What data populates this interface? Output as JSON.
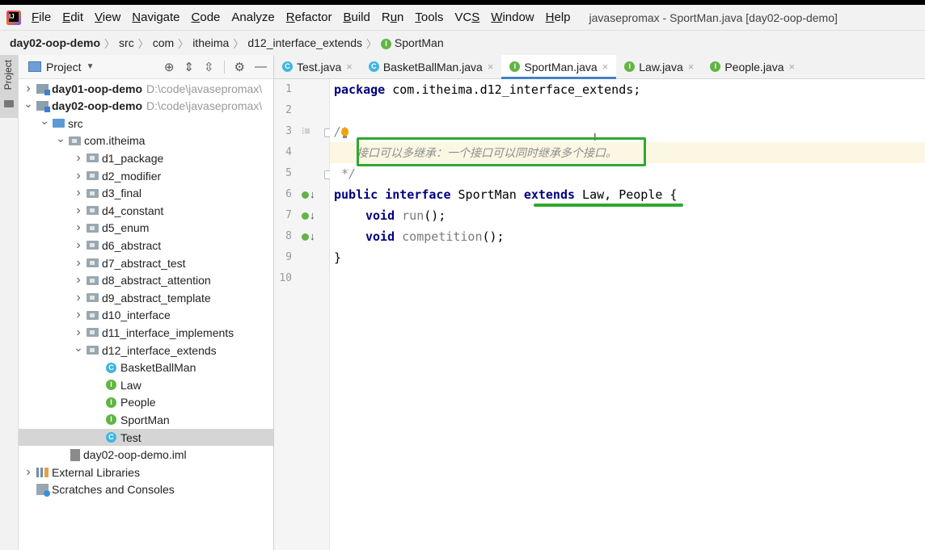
{
  "menubar": {
    "items": [
      {
        "label": "File",
        "u": "F",
        "rest": "ile"
      },
      {
        "label": "Edit",
        "u": "E",
        "rest": "dit"
      },
      {
        "label": "View",
        "u": "V",
        "rest": "iew"
      },
      {
        "label": "Navigate",
        "u": "N",
        "rest": "avigate"
      },
      {
        "label": "Code",
        "u": "C",
        "rest": "ode"
      },
      {
        "label": "Analyze",
        "u": "",
        "rest": "Analyze"
      },
      {
        "label": "Refactor",
        "u": "R",
        "rest": "efactor"
      },
      {
        "label": "Build",
        "u": "B",
        "rest": "uild"
      },
      {
        "label": "Run",
        "pre": "R",
        "u": "u",
        "rest": "n"
      },
      {
        "label": "Tools",
        "u": "T",
        "rest": "ools"
      },
      {
        "label": "VCS",
        "pre": "VC",
        "u": "S",
        "rest": ""
      },
      {
        "label": "Window",
        "u": "W",
        "rest": "indow"
      },
      {
        "label": "Help",
        "u": "H",
        "rest": "elp"
      }
    ],
    "window_title": "javasepromax - SportMan.java [day02-oop-demo]"
  },
  "breadcrumb": [
    "day02-oop-demo",
    "src",
    "com",
    "itheima",
    "d12_interface_extends",
    "SportMan"
  ],
  "left_strip": {
    "label": "Project"
  },
  "project_panel": {
    "title": "Project",
    "tree": [
      {
        "label": "day01-oop-demo",
        "path": "D:\\code\\javasepromax\\",
        "kind": "module",
        "level": 0,
        "arrow": "right",
        "bold": true
      },
      {
        "label": "day02-oop-demo",
        "path": "D:\\code\\javasepromax\\",
        "kind": "module",
        "level": 0,
        "arrow": "down",
        "bold": true
      },
      {
        "label": "src",
        "kind": "src",
        "level": 1,
        "arrow": "down"
      },
      {
        "label": "com.itheima",
        "kind": "pkg",
        "level": 2,
        "arrow": "down"
      },
      {
        "label": "d1_package",
        "kind": "pkg",
        "level": 3,
        "arrow": "right"
      },
      {
        "label": "d2_modifier",
        "kind": "pkg",
        "level": 3,
        "arrow": "right"
      },
      {
        "label": "d3_final",
        "kind": "pkg",
        "level": 3,
        "arrow": "right"
      },
      {
        "label": "d4_constant",
        "kind": "pkg",
        "level": 3,
        "arrow": "right"
      },
      {
        "label": "d5_enum",
        "kind": "pkg",
        "level": 3,
        "arrow": "right"
      },
      {
        "label": "d6_abstract",
        "kind": "pkg",
        "level": 3,
        "arrow": "right"
      },
      {
        "label": "d7_abstract_test",
        "kind": "pkg",
        "level": 3,
        "arrow": "right"
      },
      {
        "label": "d8_abstract_attention",
        "kind": "pkg",
        "level": 3,
        "arrow": "right"
      },
      {
        "label": "d9_abstract_template",
        "kind": "pkg",
        "level": 3,
        "arrow": "right"
      },
      {
        "label": "d10_interface",
        "kind": "pkg",
        "level": 3,
        "arrow": "right"
      },
      {
        "label": "d11_interface_implements",
        "kind": "pkg",
        "level": 3,
        "arrow": "right"
      },
      {
        "label": "d12_interface_extends",
        "kind": "pkg",
        "level": 3,
        "arrow": "down"
      },
      {
        "label": "BasketBallMan",
        "kind": "class",
        "level": 4
      },
      {
        "label": "Law",
        "kind": "interface",
        "level": 4
      },
      {
        "label": "People",
        "kind": "interface",
        "level": 4
      },
      {
        "label": "SportMan",
        "kind": "interface",
        "level": 4
      },
      {
        "label": "Test",
        "kind": "class",
        "level": 4,
        "selected": true
      },
      {
        "label": "day02-oop-demo.iml",
        "kind": "file",
        "level": 2
      },
      {
        "label": "External Libraries",
        "kind": "lib",
        "level": 0,
        "arrow": "right"
      },
      {
        "label": "Scratches and Consoles",
        "kind": "scratch",
        "level": 0
      }
    ]
  },
  "editor_tabs": [
    {
      "label": "Test.java",
      "kind": "class",
      "active": false
    },
    {
      "label": "BasketBallMan.java",
      "kind": "class",
      "active": false
    },
    {
      "label": "SportMan.java",
      "kind": "interface",
      "active": true
    },
    {
      "label": "Law.java",
      "kind": "interface",
      "active": false
    },
    {
      "label": "People.java",
      "kind": "interface",
      "active": false
    }
  ],
  "badges": {
    "class": "C",
    "interface": "I"
  },
  "colors": {
    "keyword": "#000080",
    "highlight_box": "#2ea82e",
    "active_tab": "#4083c9"
  },
  "code": {
    "line_numbers": [
      "1",
      "2",
      "3",
      "4",
      "5",
      "6",
      "7",
      "8",
      "9",
      "10"
    ],
    "pkg_kw": "package",
    "pkg_name": " com.itheima.d12_interface_extends;",
    "comment_open": "/*",
    "comment_text": "接口可以多继承：一个接口可以同时继承多个接口。",
    "comment_close": " */",
    "l6_public": "public",
    "l6_interface": "interface",
    "l6_name": " SportMan ",
    "l6_extends": "extends",
    "l6_rest": " Law, People {",
    "l7_void": "void",
    "l7_method": "run",
    "l7_tail": "();",
    "l8_void": "void",
    "l8_method": "competition",
    "l8_tail": "();",
    "l9": "}"
  }
}
